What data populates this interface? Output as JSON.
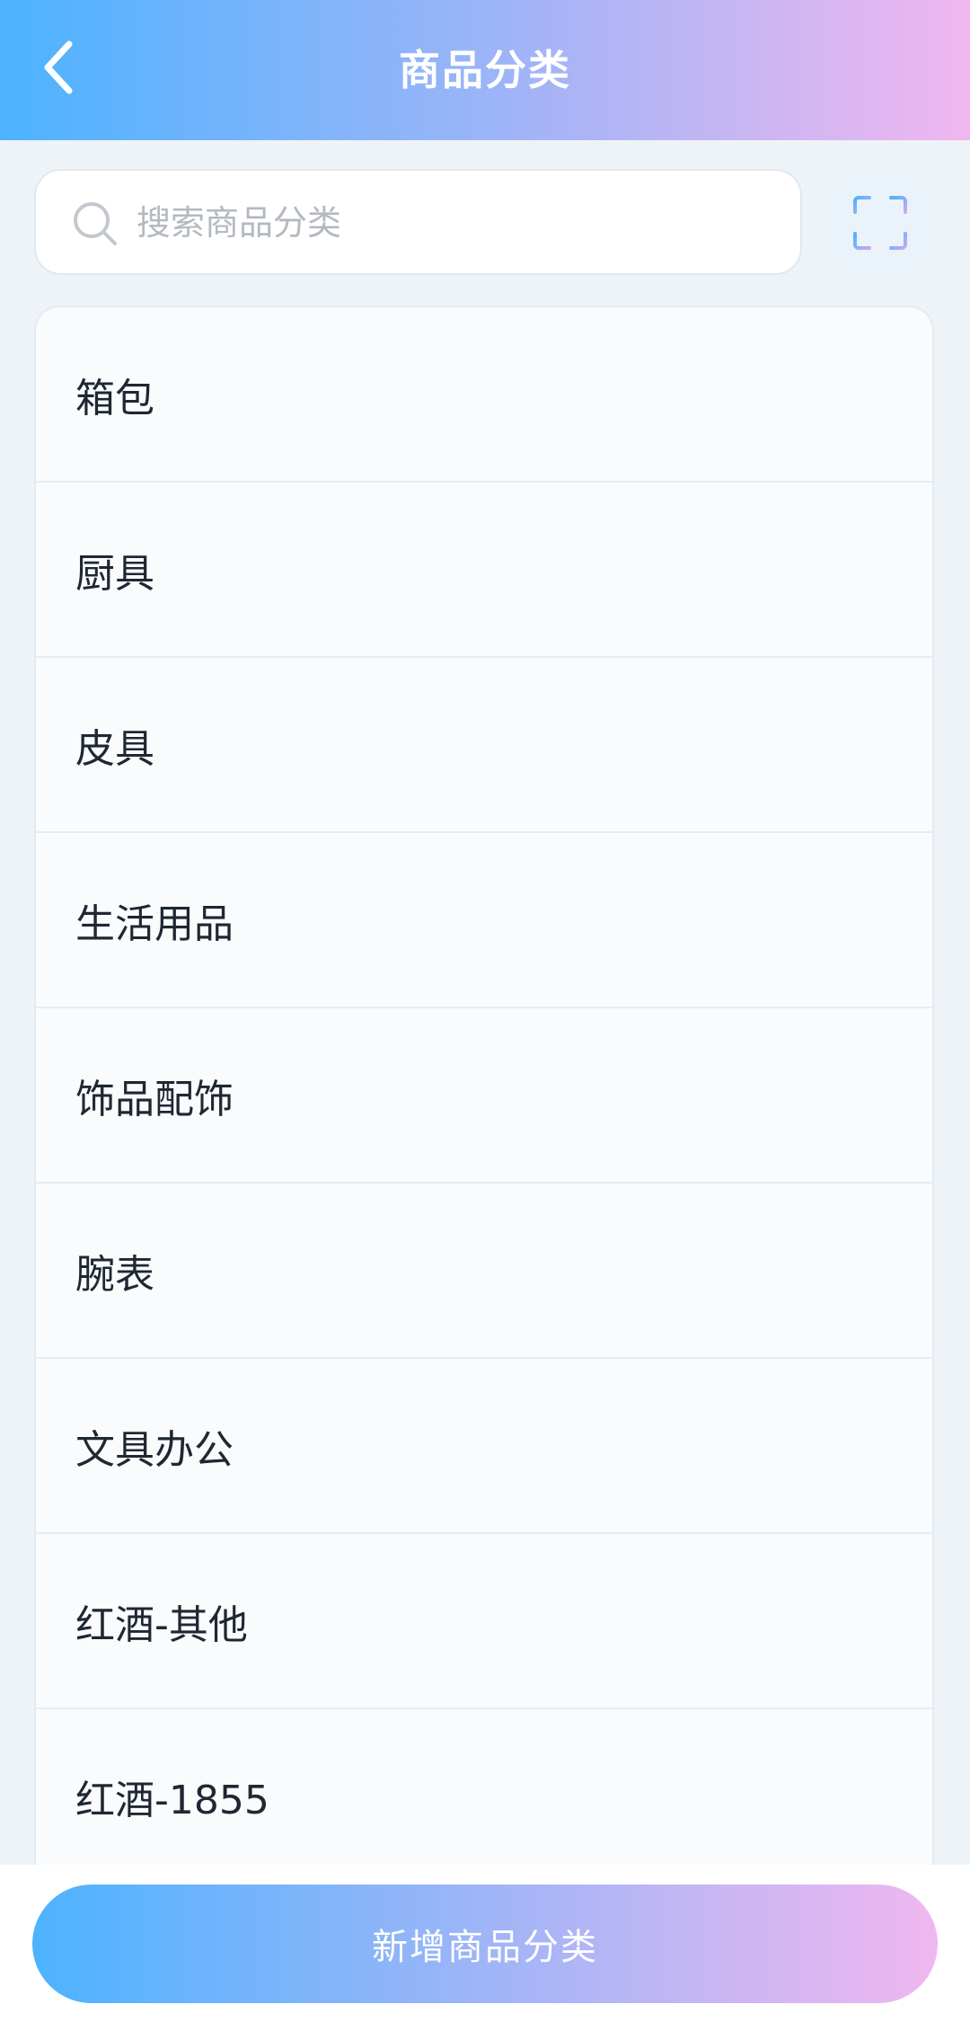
{
  "header": {
    "title": "商品分类",
    "back_icon": "chevron-left-icon"
  },
  "search": {
    "placeholder": "搜索商品分类",
    "value": "",
    "icon": "search-icon"
  },
  "scan": {
    "icon": "scan-icon"
  },
  "categories": [
    {
      "label": "箱包"
    },
    {
      "label": "厨具"
    },
    {
      "label": "皮具"
    },
    {
      "label": "生活用品"
    },
    {
      "label": "饰品配饰"
    },
    {
      "label": "腕表"
    },
    {
      "label": "文具办公"
    },
    {
      "label": "红酒-其他"
    },
    {
      "label": "红酒-1855"
    }
  ],
  "footer": {
    "add_label": "新增商品分类"
  },
  "colors": {
    "gradient_start": "#4db3ff",
    "gradient_mid": "#a3b4f7",
    "gradient_end": "#f0b7ef",
    "text_primary": "#1f2733",
    "placeholder": "#b4b9c0"
  }
}
